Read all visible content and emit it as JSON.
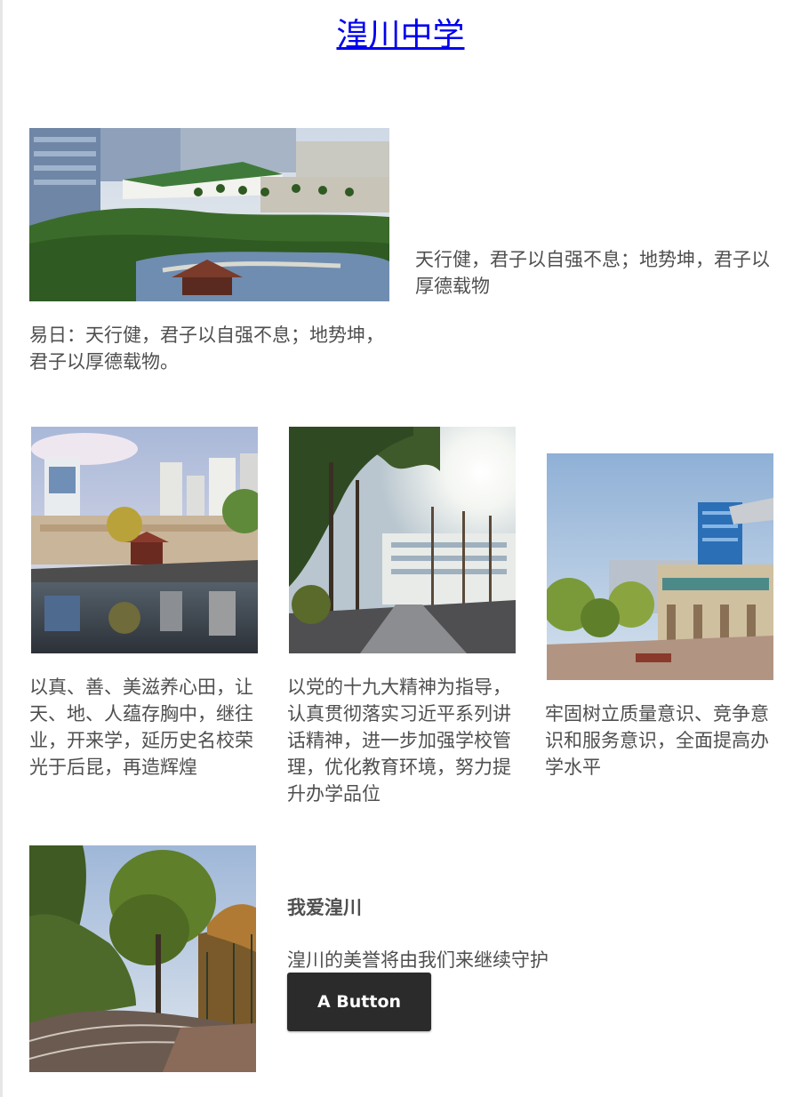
{
  "header": {
    "title": "湟川中学"
  },
  "hero": {
    "image_caption": "易日：天行健，君子以自强不息；地势坤，君子以厚德载物。",
    "side_text": "天行健，君子以自强不息；地势坤，君子以厚德载物"
  },
  "columns": [
    {
      "text": "以真、善、美滋养心田，让天、地、人蕴存胸中，继往业，开来学，延历史名校荣光于后昆，再造辉煌"
    },
    {
      "text": "以党的十九大精神为指导，认真贯彻落实习近平系列讲话精神，进一步加强学校管理，优化教育环境，努力提升办学品位"
    },
    {
      "text": "牢固树立质量意识、竞争意识和服务意识，全面提高办学水平"
    }
  ],
  "feature": {
    "heading": "我爱湟川",
    "body": "湟川的美誉将由我们来继续守护",
    "button_label": "A Button"
  },
  "colors": {
    "link": "#0000ee",
    "text": "#4f4f4f",
    "button_bg": "#2b2b2b",
    "button_text": "#ffffff"
  }
}
